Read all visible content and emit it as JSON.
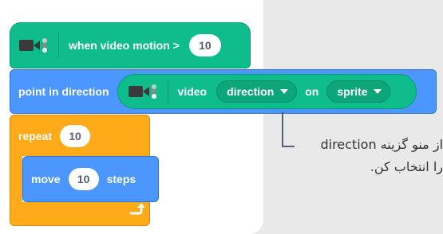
{
  "hat_block": {
    "label": "when video motion >",
    "value": "10"
  },
  "point_block": {
    "label": "point in direction"
  },
  "video_reporter": {
    "label": "video",
    "attribute": "direction",
    "on_label": "on",
    "target": "sprite"
  },
  "repeat_block": {
    "label": "repeat",
    "value": "10"
  },
  "move_block": {
    "label": "move",
    "value": "10",
    "suffix": "steps"
  },
  "annotation": {
    "line1": "از منو گزینه direction",
    "line2": "را انتخاب کن."
  },
  "icons": [
    "video-camera-icon",
    "loop-arrow-icon",
    "caret-down-icon"
  ],
  "colors": {
    "green": "#0fbd8c",
    "blue": "#4c97ff",
    "orange": "#ffab19",
    "background": "#e9e9ea"
  }
}
